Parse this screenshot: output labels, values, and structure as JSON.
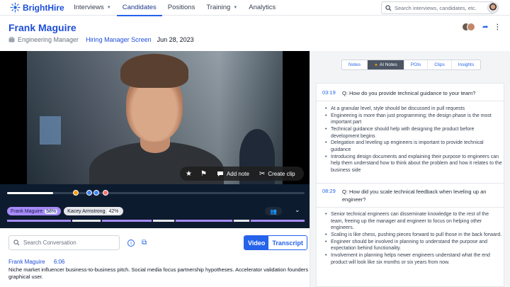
{
  "nav": {
    "brand": "BrightHire",
    "items": [
      {
        "label": "Interviews",
        "has_caret": true
      },
      {
        "label": "Candidates",
        "active": true
      },
      {
        "label": "Positions"
      },
      {
        "label": "Training",
        "has_caret": true
      },
      {
        "label": "Analytics"
      }
    ],
    "search_placeholder": "Search interviews, candidates, etc."
  },
  "header": {
    "candidate_name": "Frank Maguire",
    "role": "Engineering Manager",
    "stage": "Hiring Manager Screen",
    "date": "Jun 28, 2023"
  },
  "player": {
    "clip_actions": {
      "add_note": "Add note",
      "create_clip": "Create clip"
    },
    "progress_fraction": 0.155,
    "speakers": [
      {
        "name": "Frank Maguire",
        "pct": "58%"
      },
      {
        "name": "Kacey Armstrong",
        "pct": "42%"
      }
    ]
  },
  "conversation": {
    "search_placeholder": "Search Conversation",
    "view_toggle": {
      "video": "Video",
      "transcript": "Transcript"
    },
    "entry": {
      "speaker": "Frank Maguire",
      "time": "6:06",
      "text": "Niche market influencer business-to-business pitch. Social media focus partnership hypotheses. Accelerator validation founders graphical user."
    }
  },
  "side_panel": {
    "tabs": [
      "Notes",
      "AI Notes",
      "POIs",
      "Clips",
      "Insights"
    ],
    "active_tab": "AI Notes",
    "questions": [
      {
        "time": "03:19",
        "text": "Q: How do you provide technical guidance to your team?",
        "bullets": [
          "At a granular level, style should be discussed in pull requests",
          "Engineering is more than just programming; the design phase is the most important part",
          "Technical guidance should help with designing the product before development begins",
          "Delegation and leveling up engineers is important to provide technical guidance",
          "Introducing design documents and explaining their purpose to engineers can help them understand how to think about the problem and how it relates to the business side"
        ]
      },
      {
        "time": "08:29",
        "text": "Q: How did you scale technical feedback when leveling up an engineer?",
        "bullets": [
          "Senior technical engineers can disseminate knowledge to the rest of the team, freeing up the manager and engineer to focus on helping other engineers.",
          "Scaling is like chess, pushing pieces forward to pull those in the back forward.",
          "Engineer should be involved in planning to understand the purpose and expectation behind functionality.",
          "Involvement in planning helps newer engineers understand what the end product will look like six months or six years from now."
        ]
      }
    ]
  },
  "colors": {
    "brand_blue": "#2563eb",
    "player_bg": "#0d1b2e",
    "speaker1": "#a78bfa",
    "speaker2": "#e5e7eb"
  }
}
